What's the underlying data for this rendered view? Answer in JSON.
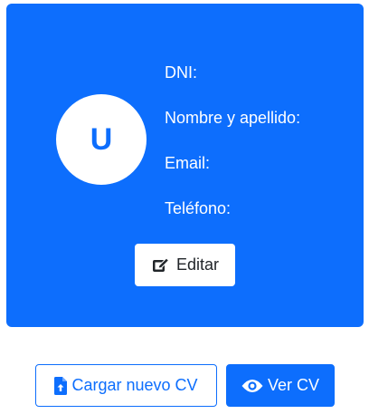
{
  "profile": {
    "avatar_initial": "U",
    "dni_label": "DNI:",
    "name_label": "Nombre y apellido:",
    "email_label": "Email:",
    "phone_label": "Teléfono:",
    "edit_label": "Editar",
    "edit_icon": "pen-to-square-icon"
  },
  "actions": {
    "upload_label": "Cargar nuevo CV",
    "upload_icon": "file-upload-icon",
    "view_label": "Ver CV",
    "view_icon": "eye-icon"
  },
  "colors": {
    "primary": "#0d6efd",
    "card_text": "#ffffff",
    "button_text_dark": "#212529"
  }
}
